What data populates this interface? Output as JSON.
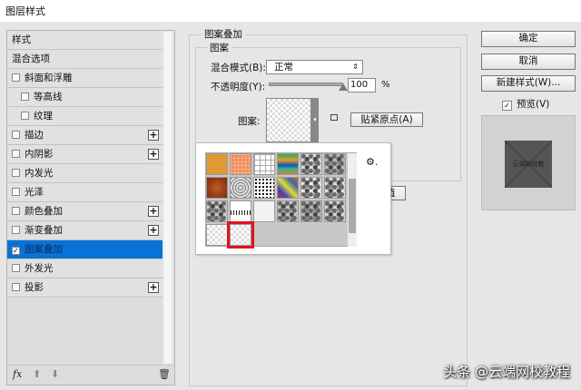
{
  "window": {
    "title": "图层样式"
  },
  "sidebar": {
    "items": [
      {
        "label": "样式",
        "checkbox": false,
        "plus": false,
        "indent": 0
      },
      {
        "label": "混合选项",
        "checkbox": false,
        "plus": false,
        "indent": 0
      },
      {
        "label": "斜面和浮雕",
        "checkbox": true,
        "checked": false,
        "plus": false,
        "indent": 0
      },
      {
        "label": "等高线",
        "checkbox": true,
        "checked": false,
        "plus": false,
        "indent": 1
      },
      {
        "label": "纹理",
        "checkbox": true,
        "checked": false,
        "plus": false,
        "indent": 1
      },
      {
        "label": "描边",
        "checkbox": true,
        "checked": false,
        "plus": true,
        "indent": 0
      },
      {
        "label": "内阴影",
        "checkbox": true,
        "checked": false,
        "plus": true,
        "indent": 0
      },
      {
        "label": "内发光",
        "checkbox": true,
        "checked": false,
        "plus": false,
        "indent": 0
      },
      {
        "label": "光泽",
        "checkbox": true,
        "checked": false,
        "plus": false,
        "indent": 0
      },
      {
        "label": "颜色叠加",
        "checkbox": true,
        "checked": false,
        "plus": true,
        "indent": 0
      },
      {
        "label": "渐变叠加",
        "checkbox": true,
        "checked": false,
        "plus": true,
        "indent": 0
      },
      {
        "label": "图案叠加",
        "checkbox": true,
        "checked": true,
        "plus": false,
        "indent": 0,
        "selected": true
      },
      {
        "label": "外发光",
        "checkbox": true,
        "checked": false,
        "plus": false,
        "indent": 0
      },
      {
        "label": "投影",
        "checkbox": true,
        "checked": false,
        "plus": true,
        "indent": 0
      }
    ],
    "toolbar": {
      "fx": "fx"
    }
  },
  "main": {
    "group_title": "图案叠加",
    "subgroup_title": "图案",
    "blend_mode_label": "混合模式(B):",
    "blend_mode_value": "正常",
    "opacity_label": "不透明度(Y):",
    "opacity_value": "100",
    "opacity_unit": "%",
    "opacity_percent": 100,
    "pattern_label": "图案:",
    "snap_button": "贴紧原点(A)",
    "hidden_button_partial": "值"
  },
  "actions": {
    "ok": "确定",
    "cancel": "取消",
    "new_style": "新建样式(W)...",
    "preview_label": "预览(V)",
    "preview_checked": true,
    "preview_text": "云端网校教"
  },
  "watermark": "头条 @云端网校教程",
  "colors": {
    "selection": "#0a72d6",
    "highlight": "#e0141c"
  }
}
